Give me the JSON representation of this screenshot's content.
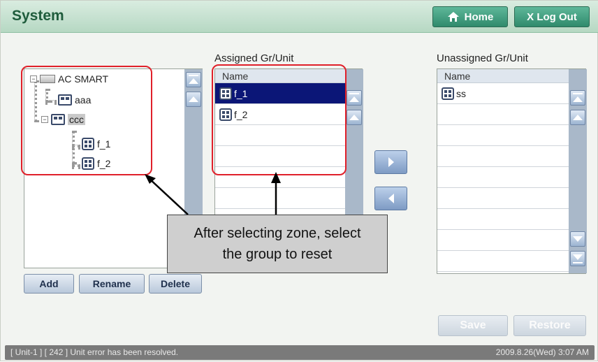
{
  "header": {
    "title": "System",
    "home_label": "Home",
    "logout_label": "X Log Out"
  },
  "tree": {
    "root": "AC SMART",
    "nodes": [
      "aaa",
      "ccc",
      "f_1",
      "f_2"
    ],
    "selected": "ccc",
    "buttons": {
      "add": "Add",
      "rename": "Rename",
      "delete": "Delete"
    }
  },
  "assigned": {
    "label": "Assigned Gr/Unit",
    "column": "Name",
    "rows": [
      "f_1",
      "f_2"
    ],
    "selected_row": "f_1"
  },
  "unassigned": {
    "label": "Unassigned Gr/Unit",
    "column": "Name",
    "rows": [
      "ss"
    ]
  },
  "actions": {
    "save": "Save",
    "restore": "Restore"
  },
  "callout": {
    "line1": "After selecting zone, select",
    "line2": "the group to reset"
  },
  "status": {
    "message": "[ Unit-1 ] [ 242 ] Unit error has been resolved.",
    "datetime": "2009.8.26(Wed)  3:07 AM"
  },
  "colors": {
    "header": "#b6d8c3",
    "accent": "#2f8a6c",
    "highlight": "#e0202a",
    "selection": "#0b1677"
  }
}
